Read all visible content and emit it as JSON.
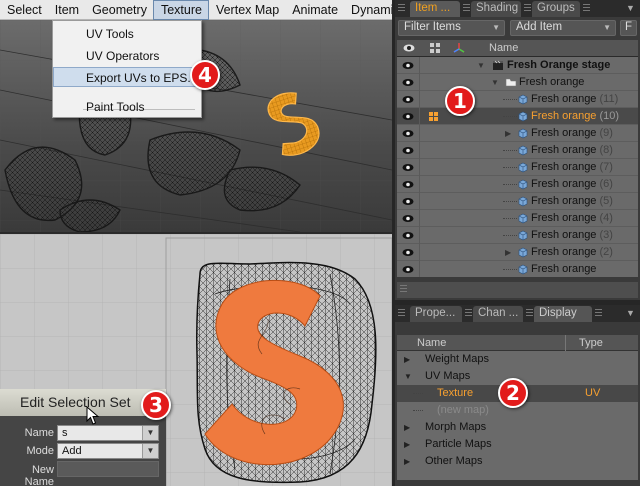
{
  "menubar": {
    "items": [
      "Select",
      "Item",
      "Geometry",
      "Texture",
      "Vertex Map",
      "Animate",
      "Dynamics"
    ],
    "active": "Texture"
  },
  "texture_menu": {
    "items": [
      "UV Tools",
      "UV Operators",
      "Export UVs to EPS...",
      "Paint Tools"
    ],
    "highlighted": "Export UVs to EPS..."
  },
  "edit_selection": {
    "title": "Edit Selection Set",
    "name_label": "Name",
    "name_value": "s",
    "mode_label": "Mode",
    "mode_value": "Add",
    "new_name_label": "New Name",
    "new_name_value": ""
  },
  "items_panel": {
    "tabs": [
      "Item ...",
      "Shading",
      "Groups"
    ],
    "active_tab": "Item ...",
    "filter_label": "Filter Items",
    "add_item_label": "Add Item",
    "f_label": "F",
    "name_header": "Name",
    "tree": [
      {
        "label": "Fresh Orange stage",
        "count": "",
        "type": "scene",
        "selected": false
      },
      {
        "label": "Fresh orange",
        "count": "",
        "type": "group",
        "selected": false
      },
      {
        "label": "Fresh orange",
        "count": "(11)",
        "type": "mesh",
        "selected": false
      },
      {
        "label": "Fresh orange",
        "count": "(10)",
        "type": "mesh",
        "selected": true
      },
      {
        "label": "Fresh orange",
        "count": "(9)",
        "type": "mesh",
        "selected": false
      },
      {
        "label": "Fresh orange",
        "count": "(8)",
        "type": "mesh",
        "selected": false
      },
      {
        "label": "Fresh orange",
        "count": "(7)",
        "type": "mesh",
        "selected": false
      },
      {
        "label": "Fresh orange",
        "count": "(6)",
        "type": "mesh",
        "selected": false
      },
      {
        "label": "Fresh orange",
        "count": "(5)",
        "type": "mesh",
        "selected": false
      },
      {
        "label": "Fresh orange",
        "count": "(4)",
        "type": "mesh",
        "selected": false
      },
      {
        "label": "Fresh orange",
        "count": "(3)",
        "type": "mesh",
        "selected": false
      },
      {
        "label": "Fresh orange",
        "count": "(2)",
        "type": "mesh",
        "selected": false
      },
      {
        "label": "Fresh orange",
        "count": "",
        "type": "mesh",
        "selected": false
      }
    ]
  },
  "vmap_panel": {
    "tabs": [
      "Prope...",
      "Chan ...",
      "Display"
    ],
    "active_tab": "Display",
    "col_name": "Name",
    "col_type": "Type",
    "rows": [
      {
        "label": "Weight Maps",
        "type": ""
      },
      {
        "label": "UV Maps",
        "type": ""
      },
      {
        "label": "Texture",
        "type": "UV"
      },
      {
        "label": "(new map)",
        "type": ""
      },
      {
        "label": "Morph Maps",
        "type": ""
      },
      {
        "label": "Particle Maps",
        "type": ""
      },
      {
        "label": "Other Maps",
        "type": ""
      }
    ]
  },
  "callouts": [
    "1",
    "2",
    "3",
    "4"
  ],
  "colors": {
    "accent_orange": "#f7a030",
    "uv_orange": "#ef7a3e",
    "callout_red": "#e21b1b"
  }
}
